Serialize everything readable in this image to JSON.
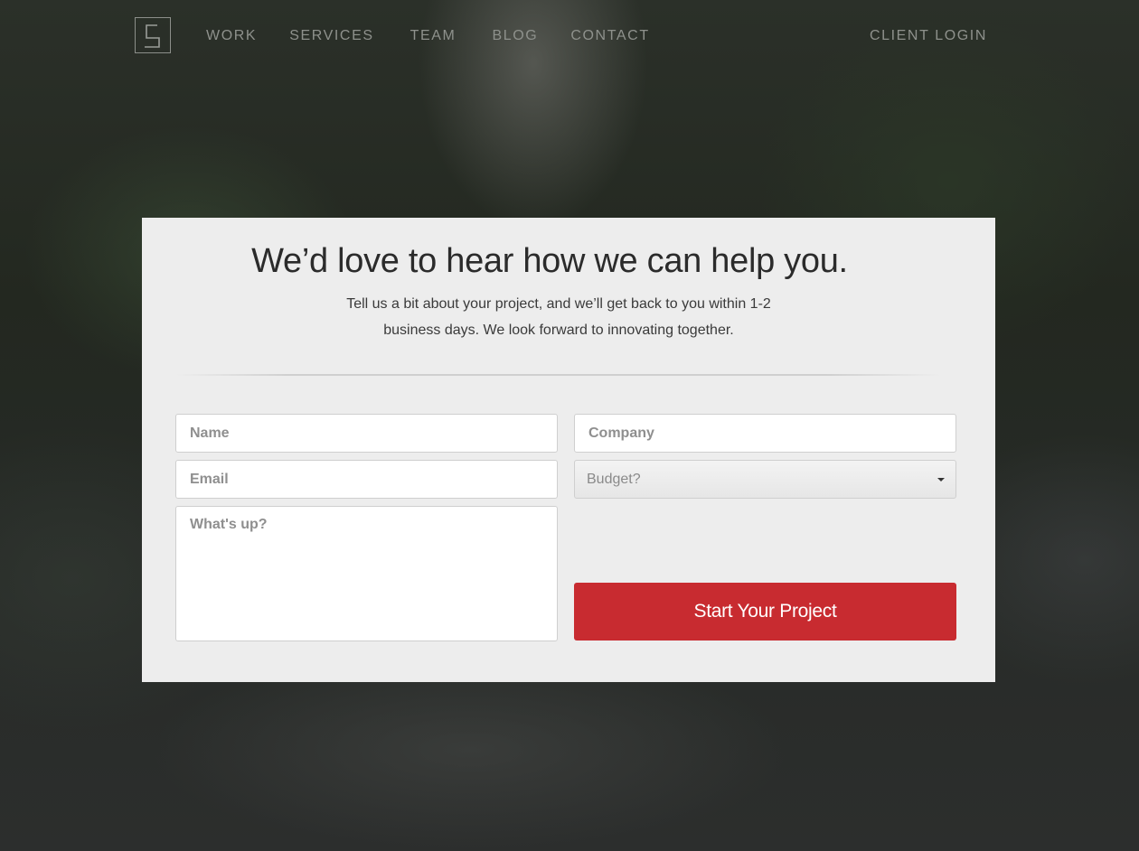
{
  "nav": {
    "links": [
      {
        "label": "WORK"
      },
      {
        "label": "SERVICES"
      },
      {
        "label": "TEAM"
      },
      {
        "label": "BLOG"
      },
      {
        "label": "CONTACT"
      }
    ],
    "client_login": "CLIENT LOGIN"
  },
  "contact": {
    "heading": "We’d love to hear how we can help you.",
    "subtext": "Tell us a bit about your project, and we’ll get back to you within 1-2 business days. We look forward to innovating together."
  },
  "form": {
    "name": {
      "placeholder": "Name",
      "value": ""
    },
    "company": {
      "placeholder": "Company",
      "value": ""
    },
    "email": {
      "placeholder": "Email",
      "value": ""
    },
    "budget": {
      "selected": "Budget?"
    },
    "message": {
      "placeholder": "What's up?",
      "value": ""
    },
    "submit_label": "Start Your Project"
  },
  "colors": {
    "accent": "#c82b30",
    "card_background": "#ededed",
    "nav_text": "#8e918c"
  },
  "icons": {
    "logo": "s-logo-icon",
    "budget_caret": "caret-down-icon"
  }
}
